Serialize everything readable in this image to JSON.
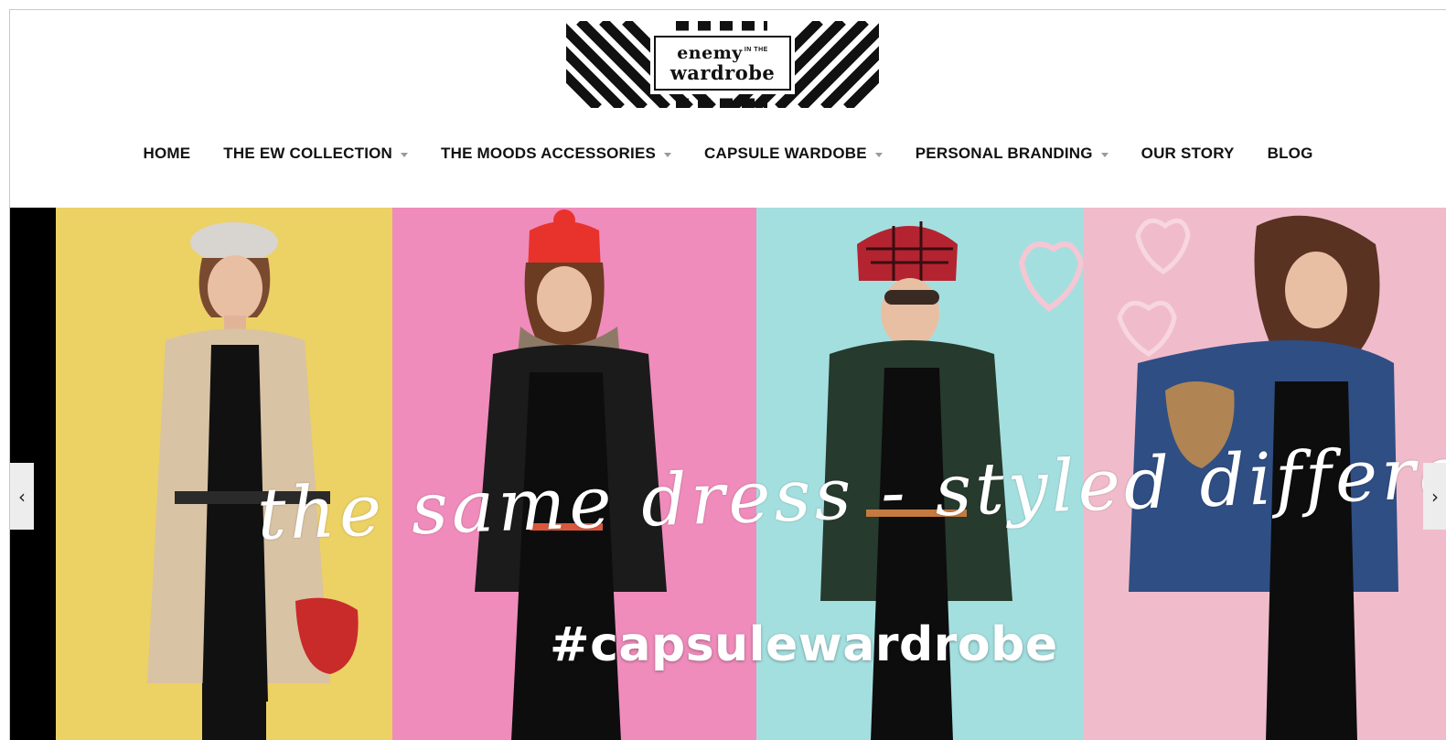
{
  "brand": {
    "line1": "enemy",
    "line1_small": "IN THE",
    "line2": "wardrobe"
  },
  "nav": {
    "items": [
      {
        "label": "HOME",
        "dropdown": false
      },
      {
        "label": "THE EW COLLECTION",
        "dropdown": true
      },
      {
        "label": "THE MOODS ACCESSORIES",
        "dropdown": true
      },
      {
        "label": "CAPSULE WARDOBE",
        "dropdown": true
      },
      {
        "label": "PERSONAL BRANDING",
        "dropdown": true
      },
      {
        "label": "OUR STORY",
        "dropdown": false
      },
      {
        "label": "BLOG",
        "dropdown": false
      }
    ]
  },
  "hero": {
    "tagline": "the same dress - styled differently",
    "hashtag": "#capsulewardrobe",
    "prev_icon": "chevron-left-icon",
    "next_icon": "chevron-right-icon",
    "prev_glyph": "‹",
    "next_glyph": "›"
  },
  "colors": {
    "panel_yellow": "#ecd165",
    "panel_pink": "#ef8cbb",
    "panel_cyan": "#a4dfe0",
    "panel_rose": "#f0bccb"
  }
}
